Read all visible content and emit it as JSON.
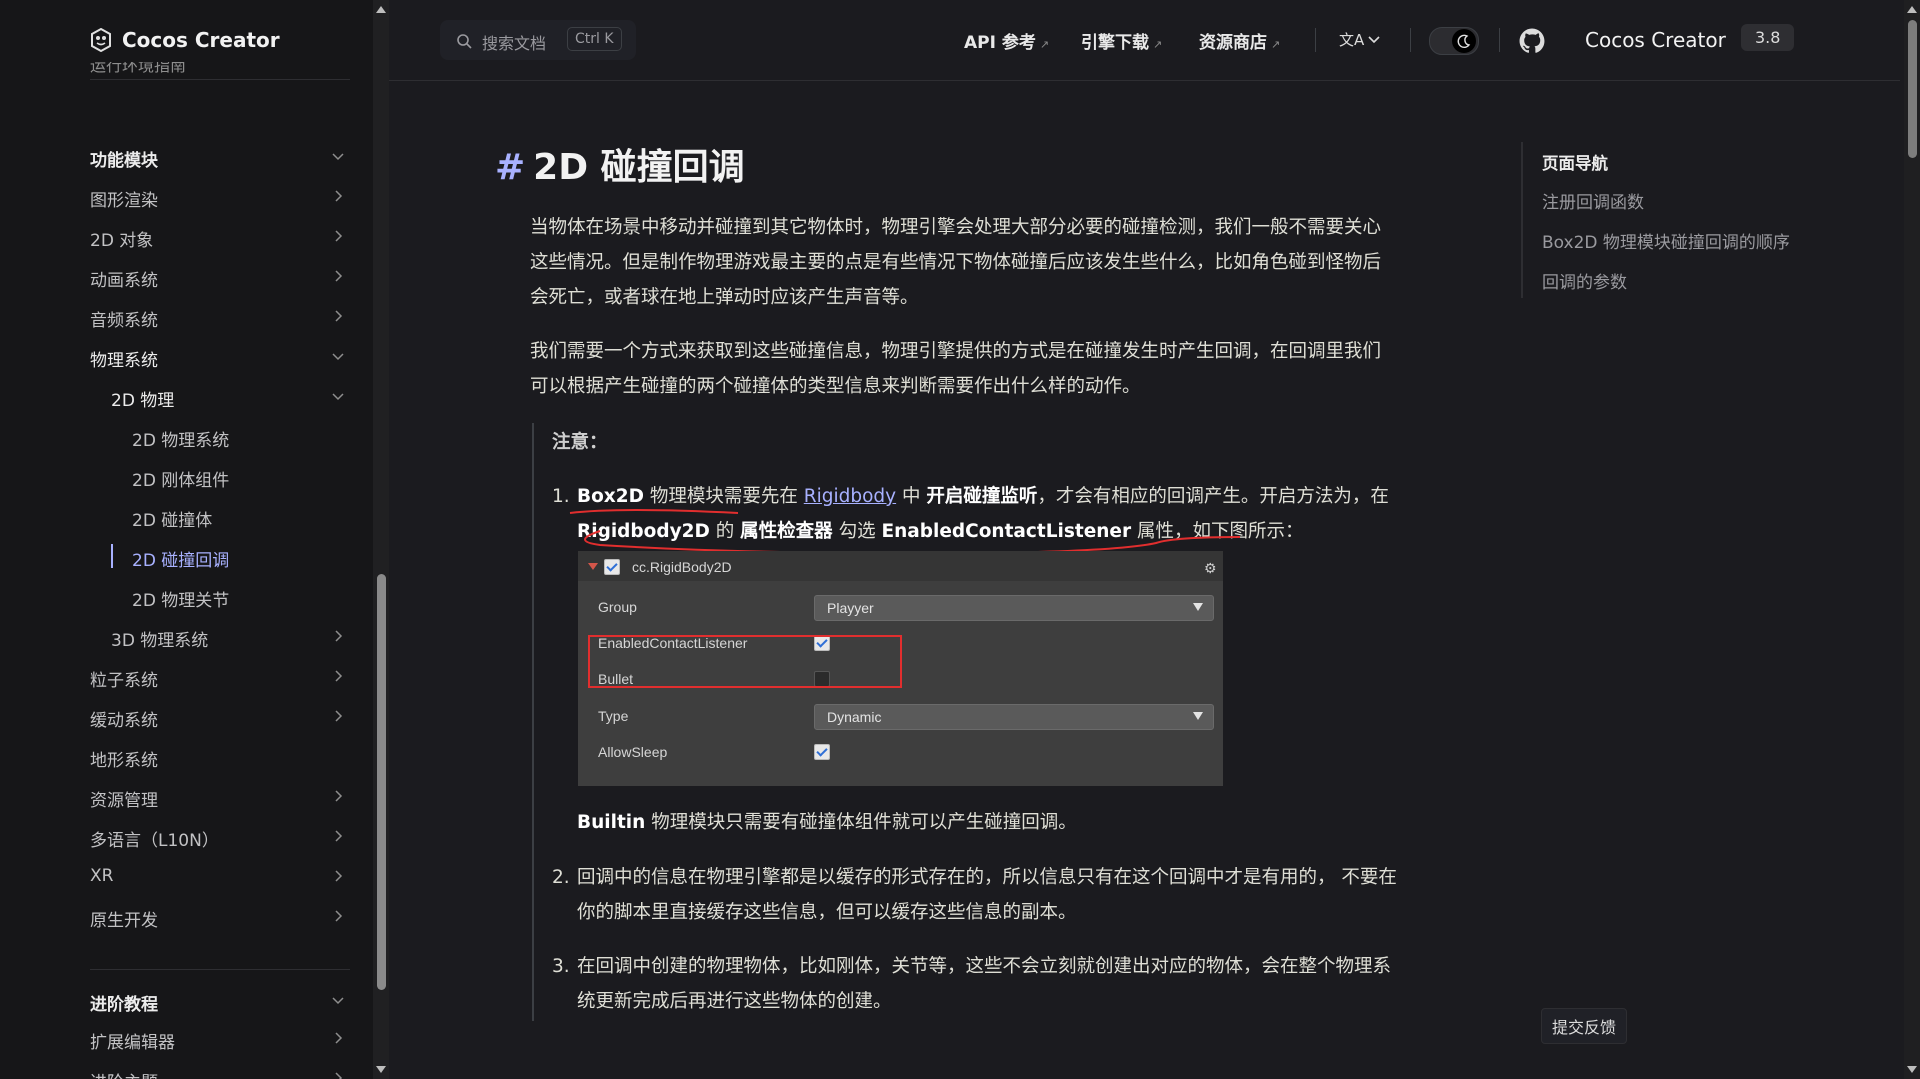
{
  "sidebar": {
    "logo_text": "Cocos Creator",
    "cut_off_text": "运行环境指南",
    "items": [
      {
        "label": "功能模块",
        "chevron": "down"
      },
      {
        "label": "图形渲染",
        "chevron": "right"
      },
      {
        "label": "2D 对象",
        "chevron": "right"
      },
      {
        "label": "动画系统",
        "chevron": "right"
      },
      {
        "label": "音频系统",
        "chevron": "right"
      },
      {
        "label": "物理系统",
        "chevron": "down"
      },
      {
        "label": "2D 物理",
        "chevron": "down"
      },
      {
        "label": "2D 物理系统",
        "chevron": ""
      },
      {
        "label": "2D 刚体组件",
        "chevron": ""
      },
      {
        "label": "2D 碰撞体",
        "chevron": ""
      },
      {
        "label": "2D 碰撞回调",
        "chevron": "",
        "active": true
      },
      {
        "label": "2D 物理关节",
        "chevron": ""
      },
      {
        "label": "3D 物理系统",
        "chevron": "right"
      },
      {
        "label": "粒子系统",
        "chevron": "right"
      },
      {
        "label": "缓动系统",
        "chevron": "right"
      },
      {
        "label": "地形系统",
        "chevron": ""
      },
      {
        "label": "资源管理",
        "chevron": "right"
      },
      {
        "label": "多语言（L10N）",
        "chevron": "right"
      },
      {
        "label": "XR",
        "chevron": "right"
      },
      {
        "label": "原生开发",
        "chevron": "right"
      },
      {
        "label": "进阶教程",
        "chevron": "down"
      },
      {
        "label": "扩展编辑器",
        "chevron": "right"
      },
      {
        "label": "进阶主题",
        "chevron": "right"
      }
    ]
  },
  "topbar": {
    "search_placeholder": "搜索文档",
    "search_shortcut": "Ctrl K",
    "links": [
      "API 参考",
      "引擎下载",
      "资源商店"
    ],
    "external_glyph": "↗",
    "lang_icon": "translate-icon",
    "brand": "Cocos Creator",
    "version": "3.8"
  },
  "main": {
    "title": "2D 碰撞回调",
    "hash": "#",
    "p1": "当物体在场景中移动并碰撞到其它物体时，物理引擎会处理大部分必要的碰撞检测，我们一般不需要关心这些情况。但是制作物理游戏最主要的点是有些情况下物体碰撞后应该发生些什么，比如角色碰到怪物后会死亡，或者球在地上弹动时应该产生声音等。",
    "p2": "我们需要一个方式来获取到这些碰撞信息，物理引擎提供的方式是在碰撞发生时产生回调，在回调里我们可以根据产生碰撞的两个碰撞体的类型信息来判断需要作出什么样的动作。",
    "note_title": "注意：",
    "item1": {
      "num": "1.",
      "b1": "Box2D",
      "t1": " 物理模块需要先在 ",
      "link": "Rigidbody",
      "t2": " 中 ",
      "b2": "开启碰撞监听",
      "t3": "，才会有相应的回调产生。开启方法为，在 ",
      "b3": "Rigidbody2D",
      "t4": " 的 ",
      "b4": "属性检查器",
      "t5": " 勾选 ",
      "b5": "EnabledContactListener",
      "t6": " 属性，如下图所示："
    },
    "after_image_b": "Builtin",
    "after_image_t": " 物理模块只需要有碰撞体组件就可以产生碰撞回调。",
    "item2": {
      "num": "2.",
      "text": "回调中的信息在物理引擎都是以缓存的形式存在的，所以信息只有在这个回调中才是有用的， 不要在你的脚本里直接缓存这些信息，但可以缓存这些信息的副本。"
    },
    "item3": {
      "num": "3.",
      "text": "在回调中创建的物理物体，比如刚体，关节等，这些不会立刻就创建出对应的物体，会在整个物理系统更新完成后再进行这些物体的创建。"
    }
  },
  "inspector": {
    "component": "cc.RigidBody2D",
    "rows": [
      {
        "label": "Group",
        "type": "dropdown",
        "value": "Playyer"
      },
      {
        "label": "EnabledContactListener",
        "type": "checkbox",
        "checked": true
      },
      {
        "label": "Bullet",
        "type": "checkbox",
        "checked": false
      },
      {
        "label": "Type",
        "type": "dropdown",
        "value": "Dynamic"
      },
      {
        "label": "AllowSleep",
        "type": "checkbox",
        "checked": true
      }
    ],
    "highlight_color": "#e12e2e"
  },
  "aside": {
    "title": "页面导航",
    "links": [
      "注册回调函数",
      "Box2D 物理模块碰撞回调的顺序",
      "回调的参数"
    ]
  },
  "feedback": "提交反馈",
  "colors": {
    "accent": "#a8b1ff",
    "background": "#1b1b1f",
    "sidebar": "#161618",
    "annotation": "#e12e2e"
  }
}
